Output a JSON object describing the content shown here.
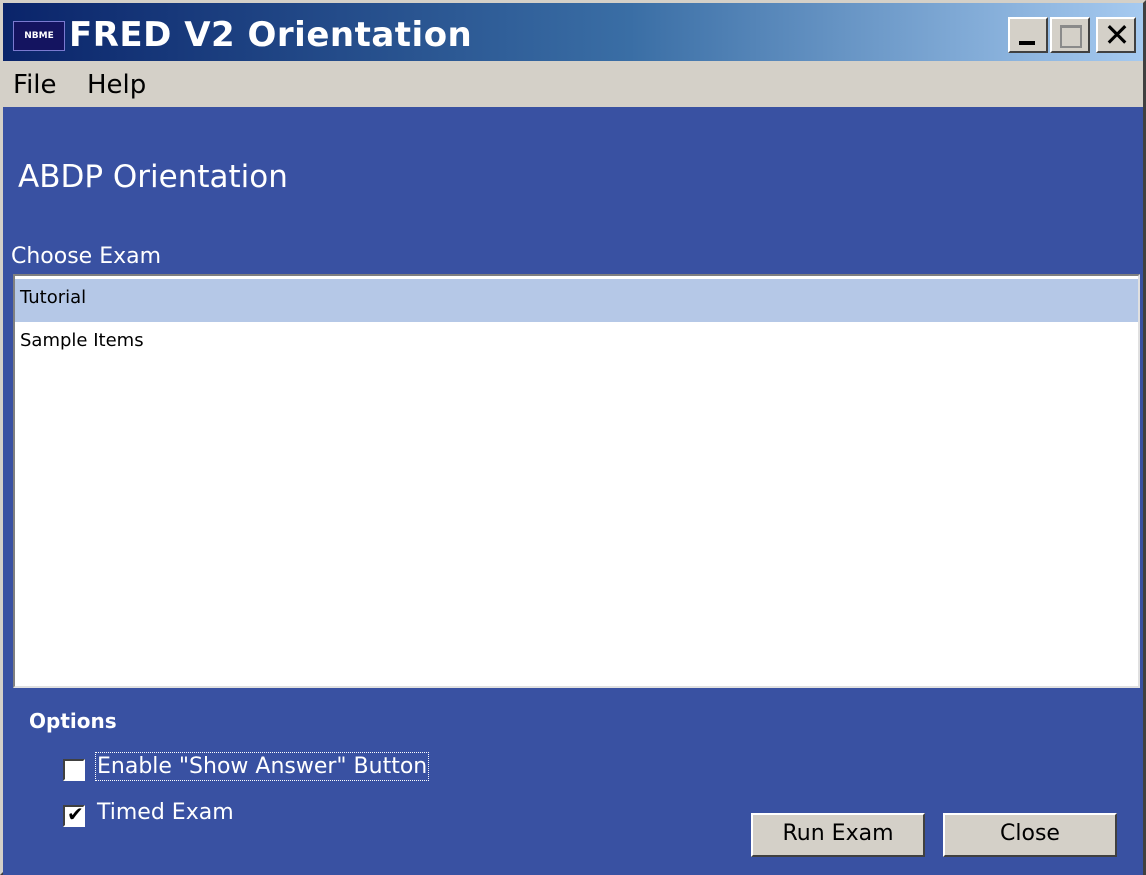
{
  "window": {
    "title": "FRED V2 Orientation",
    "icon_text": "NBME"
  },
  "menu": {
    "items": [
      "File",
      "Help"
    ]
  },
  "main": {
    "heading": "ABDP Orientation",
    "choose_label": "Choose Exam",
    "exams": [
      {
        "label": "Tutorial",
        "selected": true
      },
      {
        "label": "Sample Items",
        "selected": false
      }
    ]
  },
  "options": {
    "label": "Options",
    "show_answer": {
      "label": "Enable \"Show Answer\" Button",
      "checked": false
    },
    "timed_exam": {
      "label": "Timed Exam",
      "checked": true
    }
  },
  "buttons": {
    "run": "Run Exam",
    "close": "Close"
  },
  "colors": {
    "panel_bg": "#3951a2",
    "selection": "#b5c8e7",
    "title_gradient_start": "#0a246a",
    "title_gradient_end": "#a6caf0"
  }
}
